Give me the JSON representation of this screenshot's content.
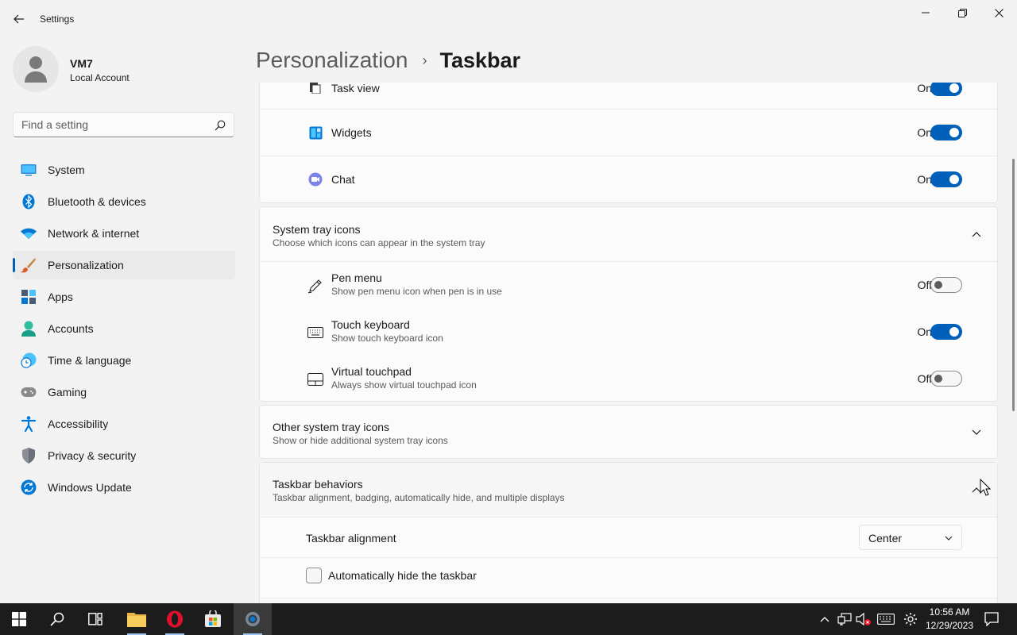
{
  "window": {
    "title": "Settings"
  },
  "profile": {
    "name": "VM7",
    "account_type": "Local Account"
  },
  "search": {
    "placeholder": "Find a setting"
  },
  "nav": {
    "items": [
      {
        "label": "System",
        "icon": "system-icon"
      },
      {
        "label": "Bluetooth & devices",
        "icon": "bluetooth-icon"
      },
      {
        "label": "Network & internet",
        "icon": "wifi-icon"
      },
      {
        "label": "Personalization",
        "icon": "brush-icon",
        "active": true
      },
      {
        "label": "Apps",
        "icon": "apps-icon"
      },
      {
        "label": "Accounts",
        "icon": "accounts-icon"
      },
      {
        "label": "Time & language",
        "icon": "time-language-icon"
      },
      {
        "label": "Gaming",
        "icon": "gamepad-icon"
      },
      {
        "label": "Accessibility",
        "icon": "accessibility-icon"
      },
      {
        "label": "Privacy & security",
        "icon": "shield-icon"
      },
      {
        "label": "Windows Update",
        "icon": "update-icon"
      }
    ]
  },
  "breadcrumb": {
    "parent": "Personalization",
    "separator": "›",
    "current": "Taskbar"
  },
  "taskbar_items": {
    "task_view": {
      "label": "Task view",
      "state": "On",
      "on": true
    },
    "widgets": {
      "label": "Widgets",
      "state": "On",
      "on": true
    },
    "chat": {
      "label": "Chat",
      "state": "On",
      "on": true
    }
  },
  "system_tray": {
    "title": "System tray icons",
    "subtitle": "Choose which icons can appear in the system tray",
    "items": {
      "pen_menu": {
        "label": "Pen menu",
        "description": "Show pen menu icon when pen is in use",
        "state": "Off",
        "on": false
      },
      "touch_keyboard": {
        "label": "Touch keyboard",
        "description": "Show touch keyboard icon",
        "state": "On",
        "on": true
      },
      "virtual_touchpad": {
        "label": "Virtual touchpad",
        "description": "Always show virtual touchpad icon",
        "state": "Off",
        "on": false
      }
    }
  },
  "other_tray": {
    "title": "Other system tray icons",
    "subtitle": "Show or hide additional system tray icons"
  },
  "behaviors": {
    "title": "Taskbar behaviors",
    "subtitle": "Taskbar alignment, badging, automatically hide, and multiple displays",
    "alignment_label": "Taskbar alignment",
    "alignment_value": "Center",
    "autohide_label": "Automatically hide the taskbar",
    "autohide_checked": false
  },
  "system_taskbar": {
    "time": "10:56 AM",
    "date": "12/29/2023"
  },
  "colors": {
    "accent": "#005fb8",
    "taskbar_bg": "#1c1c1c"
  }
}
